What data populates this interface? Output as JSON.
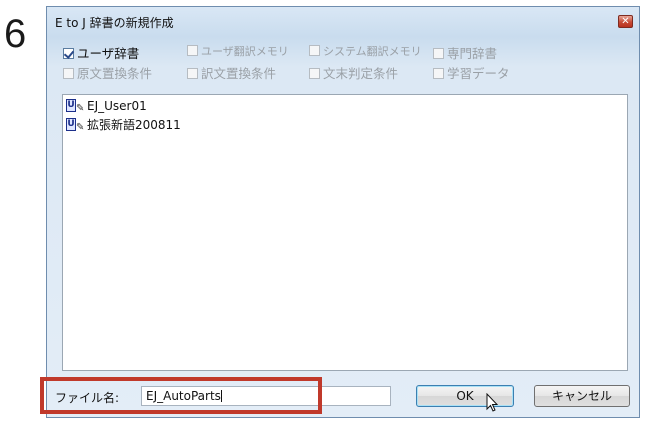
{
  "step_number": "6",
  "dialog": {
    "title": "E to J 辞書の新規作成",
    "close_glyph": "✕"
  },
  "dictionary_types": [
    {
      "label": "ユーザ辞書",
      "checked": true,
      "enabled": true
    },
    {
      "label": "ユーザ翻訳メモリ",
      "checked": false,
      "enabled": false
    },
    {
      "label": "システム翻訳メモリ",
      "checked": false,
      "enabled": false
    },
    {
      "label": "専門辞書",
      "checked": false,
      "enabled": false
    },
    {
      "label": "原文置換条件",
      "checked": false,
      "enabled": false
    },
    {
      "label": "訳文置換条件",
      "checked": false,
      "enabled": false
    },
    {
      "label": "文末判定条件",
      "checked": false,
      "enabled": false
    },
    {
      "label": "学習データ",
      "checked": false,
      "enabled": false
    }
  ],
  "dictionary_list": [
    {
      "icon": "user-dictionary-icon",
      "label": "EJ_User01"
    },
    {
      "icon": "user-dictionary-icon",
      "label": "拡張新語200811"
    }
  ],
  "file_name": {
    "label": "ファイル名:",
    "value": "EJ_AutoParts"
  },
  "buttons": {
    "ok": "OK",
    "cancel": "キャンセル"
  },
  "colors": {
    "highlight": "#c0392b",
    "title_gradient": "#c9dcee"
  }
}
